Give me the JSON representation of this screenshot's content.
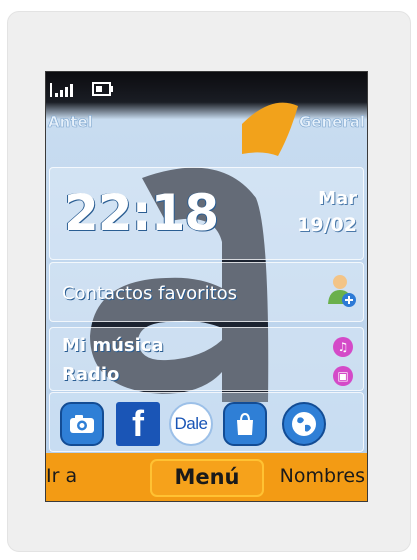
{
  "status": {
    "signal_icon": "signal-bars-icon",
    "battery_icon": "battery-icon"
  },
  "operators": {
    "left": "Antel",
    "right": "General"
  },
  "clock": {
    "time": "22:18",
    "day": "Mar",
    "date": "19/02"
  },
  "favorites": {
    "label": "Contactos favoritos",
    "icon": "add-contact-icon"
  },
  "media": {
    "music_label": "Mi música",
    "radio_label": "Radio",
    "music_icon": "music-note-icon",
    "radio_icon": "radio-icon"
  },
  "apps": [
    {
      "name": "camera",
      "icon": "camera-icon"
    },
    {
      "name": "facebook",
      "label": "f",
      "icon": "facebook-icon"
    },
    {
      "name": "dale",
      "label": "Dale",
      "icon": "dale-icon"
    },
    {
      "name": "store",
      "icon": "shopping-bag-icon"
    },
    {
      "name": "browser",
      "icon": "globe-icon"
    }
  ],
  "softkeys": {
    "left": "Ir a",
    "center": "Menú",
    "right": "Nombres"
  },
  "colors": {
    "softbar": "#f39b14",
    "wallpaper_blue": "#c3d8ee",
    "logo_dark": "#1c2330",
    "logo_orange": "#f2a21b",
    "accent_pink": "#d44ac8"
  }
}
